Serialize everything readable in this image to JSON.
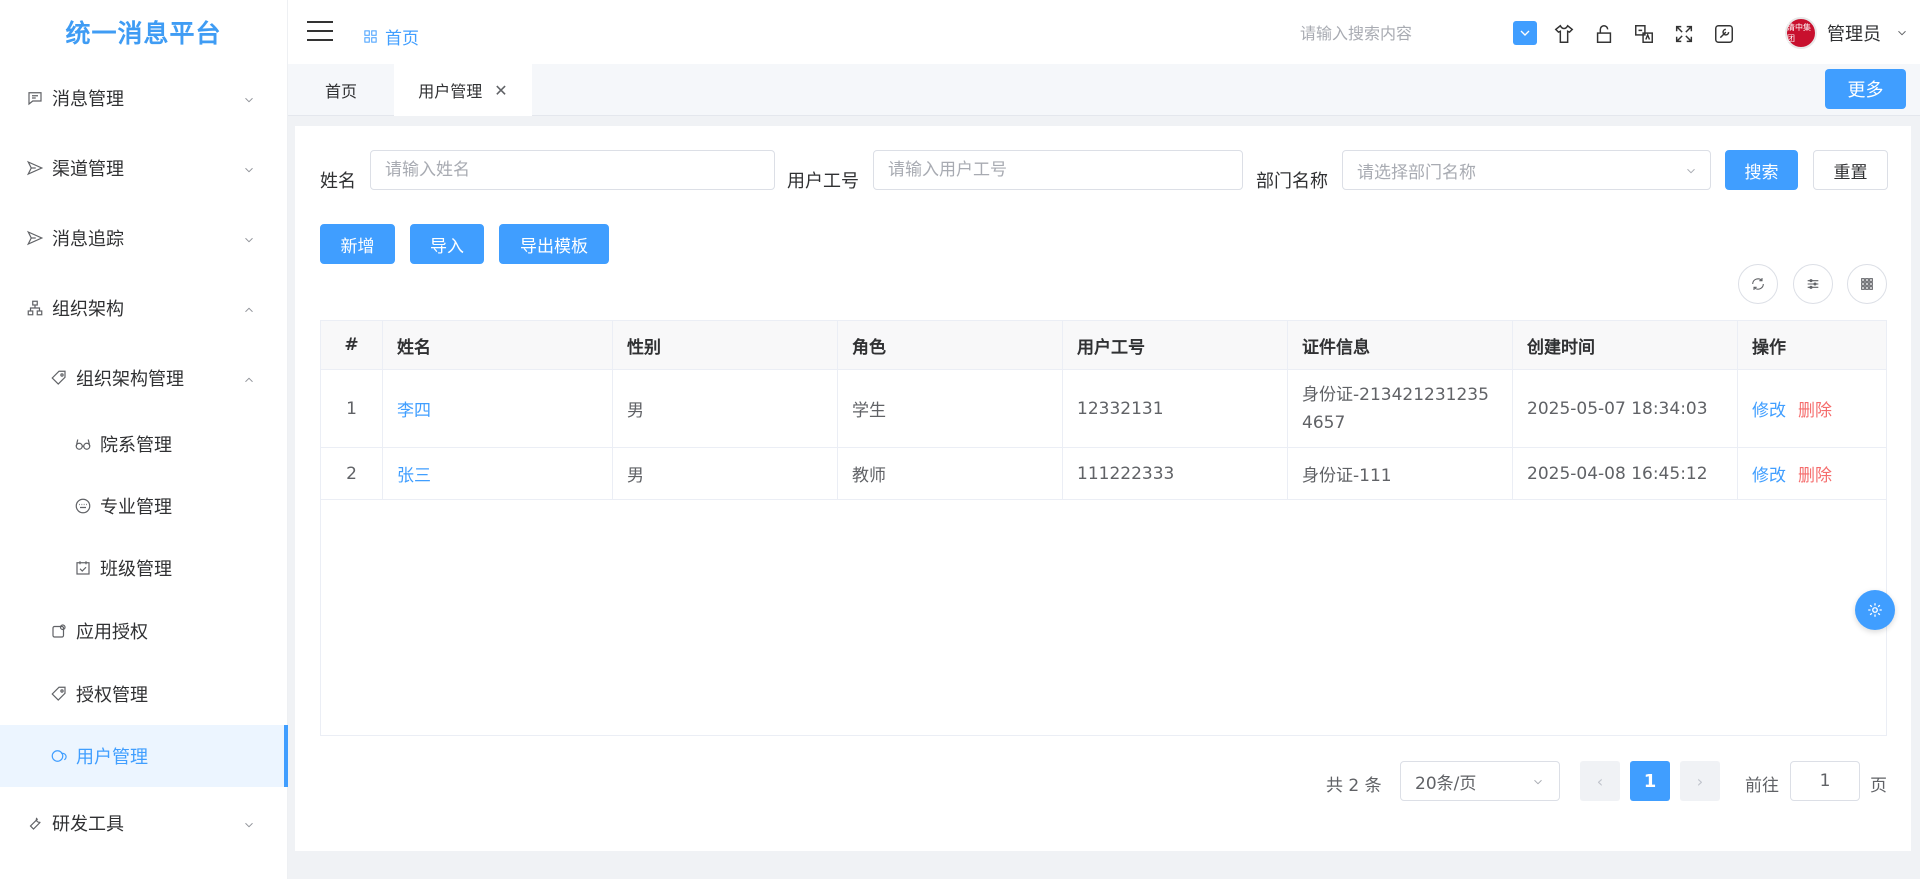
{
  "app": {
    "title": "统一消息平台"
  },
  "sidebar": {
    "items": [
      {
        "label": "消息管理",
        "icon": "message-icon"
      },
      {
        "label": "渠道管理",
        "icon": "send-icon"
      },
      {
        "label": "消息追踪",
        "icon": "send-icon"
      },
      {
        "label": "组织架构",
        "icon": "org-tree-icon"
      },
      {
        "label": "组织架构管理",
        "icon": "tag-icon"
      },
      {
        "label": "院系管理",
        "icon": "glasses-icon"
      },
      {
        "label": "专业管理",
        "icon": "keyboard-icon"
      },
      {
        "label": "班级管理",
        "icon": "calendar-icon"
      },
      {
        "label": "应用授权",
        "icon": "app-icon"
      },
      {
        "label": "授权管理",
        "icon": "tag-icon"
      },
      {
        "label": "用户管理",
        "icon": "user-icon"
      },
      {
        "label": "研发工具",
        "icon": "wrench-icon"
      }
    ]
  },
  "header": {
    "breadcrumb": "首页",
    "search_placeholder": "请输入搜索内容",
    "user_name": "管理员",
    "avatar_text": "清中集团"
  },
  "tabs": [
    {
      "label": "首页"
    },
    {
      "label": "用户管理",
      "close": "✕"
    }
  ],
  "more_label": "更多",
  "filters": {
    "name_label": "姓名",
    "name_placeholder": "请输入姓名",
    "id_label": "用户工号",
    "id_placeholder": "请输入用户工号",
    "dept_label": "部门名称",
    "dept_placeholder": "请选择部门名称",
    "search_label": "搜索",
    "reset_label": "重置"
  },
  "actions": {
    "add_label": "新增",
    "import_label": "导入",
    "export_label": "导出模板"
  },
  "table": {
    "headers": [
      "#",
      "姓名",
      "性别",
      "角色",
      "用户工号",
      "证件信息",
      "创建时间",
      "操作"
    ],
    "rows": [
      {
        "idx": "1",
        "name": "李四",
        "gender": "男",
        "role": "学生",
        "uid": "12332131",
        "cert": "身份证-2134212312354657",
        "created": "2025-05-07 18:34:03",
        "edit": "修改",
        "del": "删除"
      },
      {
        "idx": "2",
        "name": "张三",
        "gender": "男",
        "role": "教师",
        "uid": "111222333",
        "cert": "身份证-111",
        "created": "2025-04-08 16:45:12",
        "edit": "修改",
        "del": "删除"
      }
    ]
  },
  "pagination": {
    "total": "共 2 条",
    "page_size": "20条/页",
    "current": "1",
    "prev": "‹",
    "next": "›",
    "goto_label": "前往",
    "goto_value": "1",
    "page_suffix": "页"
  },
  "colors": {
    "primary": "#409eff",
    "danger": "#f56c6c",
    "brand": "#3f9cf4"
  }
}
